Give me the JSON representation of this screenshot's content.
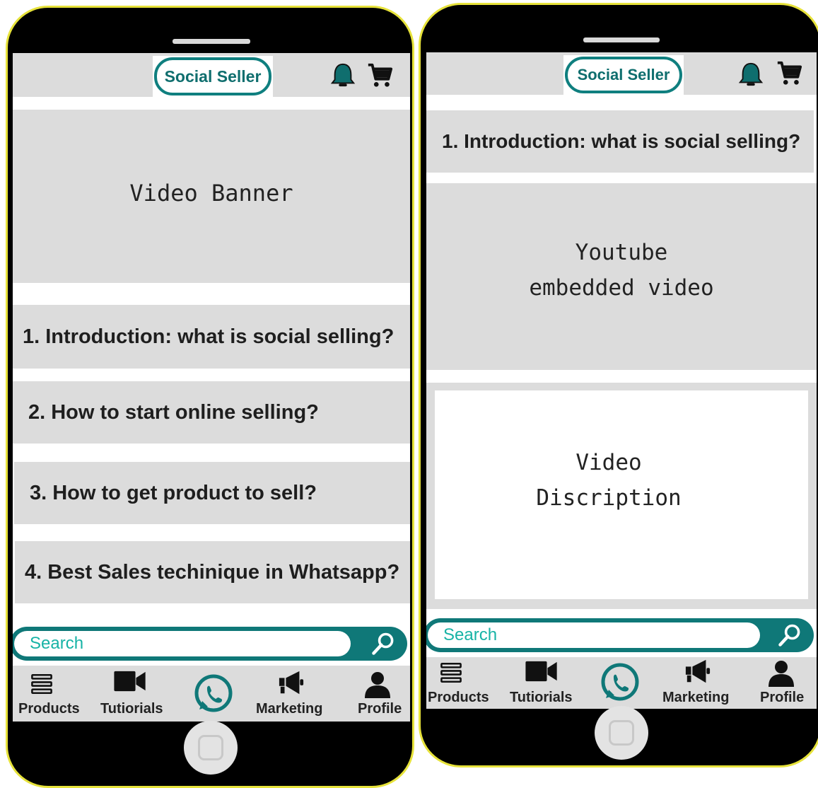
{
  "app": {
    "logo_text": "Social Seller"
  },
  "icons": [
    "bell-icon",
    "cart-icon",
    "search-icon",
    "menu-list-icon",
    "video-camera-icon",
    "whatsapp-icon",
    "megaphone-icon",
    "person-icon"
  ],
  "colors": {
    "brand_teal": "#0f7878",
    "search_text": "#17b3a6",
    "block_gray": "#dcdcdc",
    "frame_yellow": "#e6e23a"
  },
  "left_screen": {
    "banner_text": "Video Banner",
    "topics": [
      "1. Introduction: what is social selling?",
      "2. How to start online selling?",
      "3. How to get product to sell?",
      "4. Best Sales techinique in Whatsapp?"
    ],
    "search_placeholder": "Search"
  },
  "right_screen": {
    "topic_title": "1. Introduction: what is social selling?",
    "video_line1": "Youtube",
    "video_line2": "embedded video",
    "description_line1": "Video",
    "description_line2": "Discription",
    "search_placeholder": "Search"
  },
  "nav": {
    "products": "Products",
    "tutorials": "Tutiorials",
    "marketing": "Marketing",
    "profile": "Profile"
  }
}
